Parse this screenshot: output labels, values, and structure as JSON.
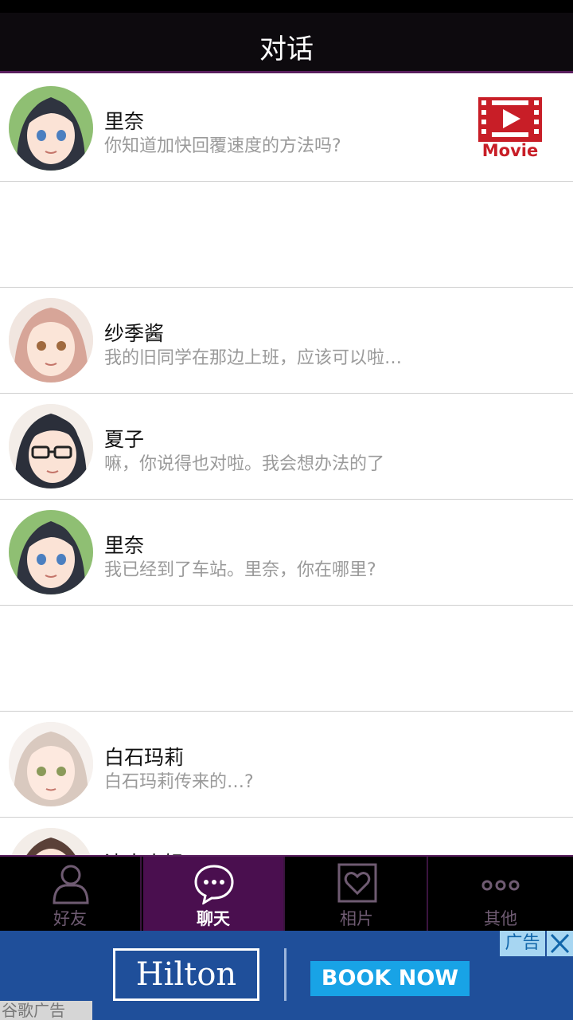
{
  "header": {
    "title": "对话"
  },
  "conversations": [
    {
      "name": "里奈",
      "message": "你知道加快回覆速度的方法吗?",
      "movie_label": "Movie"
    },
    {
      "name": "纱季酱",
      "message": "我的旧同学在那边上班，应该可以啦…"
    },
    {
      "name": "夏子",
      "message": "嘛，你说得也对啦。我会想办法的了"
    },
    {
      "name": "里奈",
      "message": "我已经到了车站。里奈，你在哪里?"
    },
    {
      "name": "白石玛莉",
      "message": "白石玛莉传来的…?"
    },
    {
      "name": "清水小姐",
      "message": ""
    }
  ],
  "tabs": [
    {
      "label": "好友",
      "icon": "person-icon",
      "active": false
    },
    {
      "label": "聊天",
      "icon": "chat-bubble-icon",
      "active": true
    },
    {
      "label": "相片",
      "icon": "heart-photo-icon",
      "active": false
    },
    {
      "label": "其他",
      "icon": "more-dots-icon",
      "active": false
    }
  ],
  "ad": {
    "brand": "Hilton",
    "cta": "BOOK NOW",
    "tag": "广告",
    "source": "谷歌广告"
  },
  "colors": {
    "header_bg": "#0d0a0e",
    "accent": "#5a1f5f",
    "active_tab": "#4a0f4f",
    "ad_bg": "#1f4f9a",
    "movie_red": "#c81e27"
  }
}
